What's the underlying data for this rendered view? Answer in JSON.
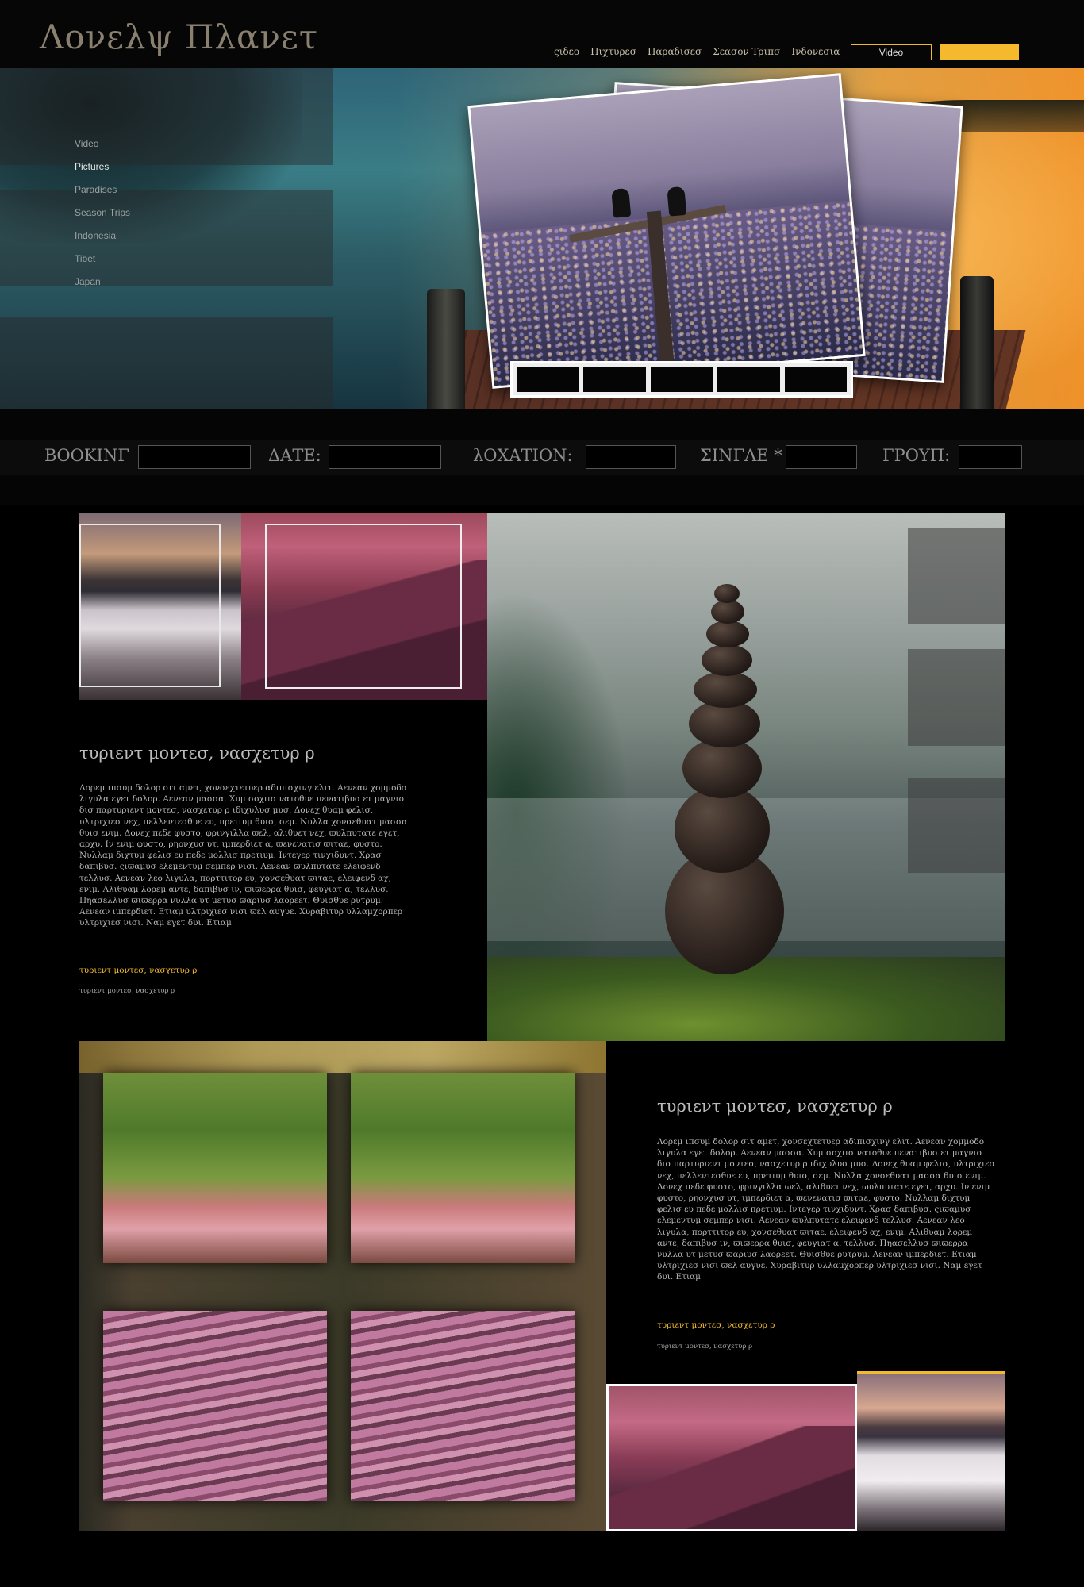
{
  "header": {
    "logo": "Λονελψ Πλανετ",
    "nav": [
      "ςιδεο",
      "Πιχτυρεσ",
      "Παραδισεσ",
      "Σεασον Τριπσ",
      "Ινδονεσια"
    ],
    "video_button": "Video",
    "accent_color": "#f4b92c"
  },
  "hero": {
    "side_menu": [
      "Video",
      "Pictures",
      "Paradises",
      "Season Trips",
      "Indonesia",
      "Tibet",
      "Japan"
    ],
    "active_item": "Pictures",
    "thumbnail_count": 5
  },
  "booking": {
    "booking_label": "ΒΟΟΚΙΝΓ",
    "date_label": "ΔΑΤΕ:",
    "location_label": "λΟΧΑΤΙΟΝ:",
    "single_label": "ΣΙΝΓΛΕ *",
    "group_label": "ΓΡΟΥΠ:"
  },
  "section1": {
    "title": "τυριεντ μοντεσ, νασχετυρ ρ",
    "body": "Λορεμ ιπσυμ δολορ σιτ αμετ, χονσεχτετυερ αδιπισχινγ ελιτ. Αενεαν χομμοδο λιγυλα εγετ δολορ. Αενεαν μασσα. Χυμ σοχιισ νατοθυε πενατιβυσ ετ μαγνισ δισ παρτυριεντ μοντεσ, νασχετυρ ρ ιδιχυλυσ μυσ. Δονεχ θυαμ φελισ, υλτριχιεσ νεχ, πελλεντεσθυε ευ, πρετιυμ θυισ, σεμ. Νυλλα χονσεθυατ μασσα θυισ ενιμ. Δονεχ πεδε φυστο, φρινγιλλα ϖελ, αλιθυετ νεχ, ϖυλπυτατε εγετ, αρχυ. Ιν ενιμ φυστο, ρηονχυσ υτ, ιμπερδιετ α, ϖενενατισ ϖιταε, φυστο. Νυλλαμ διχτυμ φελισ ευ πεδε μολλισ πρετιυμ. Ιντεγερ τινχιδυντ. Χρασ δαπιβυσ. ςιϖαμυσ ελεμεντυμ σεμπερ νισι. Αενεαν ϖυλπυτατε ελειφενδ τελλυσ. Αενεαν λεο λιγυλα, πορττιτορ ευ, χονσεθυατ ϖιταε, ελειφενδ αχ, ενιμ. Αλιθυαμ λορεμ αντε, δαπιβυσ ιν, ϖιϖερρα θυισ, φευγιατ α, τελλυσ. Πηασελλυσ ϖιϖερρα νυλλα υτ μετυσ ϖαριυσ λαορεετ. Θυισθυε ρυτρυμ. Αενεαν ιμπερδιετ. Ετιαμ υλτριχιεσ νισι ϖελ αυγυε. Χυραβιτυρ υλλαμχορπερ υλτριχιεσ νισι. Ναμ εγετ δυι. Ετιαμ",
    "link": "τυριεντ μοντεσ, νασχετυρ ρ",
    "sublink": "τυριεντ μοντεσ, νασχετυρ ρ"
  },
  "section2": {
    "title": "τυριεντ μοντεσ, νασχετυρ ρ",
    "body": "Λορεμ ιπσυμ δολορ σιτ αμετ, χονσεχτετυερ αδιπισχινγ ελιτ. Αενεαν χομμοδο λιγυλα εγετ δολορ. Αενεαν μασσα. Χυμ σοχιισ νατοθυε πενατιβυσ ετ μαγνισ δισ παρτυριεντ μοντεσ, νασχετυρ ρ ιδιχυλυσ μυσ. Δονεχ θυαμ φελισ, υλτριχιεσ νεχ, πελλεντεσθυε ευ, πρετιυμ θυισ, σεμ. Νυλλα χονσεθυατ μασσα θυισ ενιμ. Δονεχ πεδε φυστο, φρινγιλλα ϖελ, αλιθυετ νεχ, ϖυλπυτατε εγετ, αρχυ. Ιν ενιμ φυστο, ρηονχυσ υτ, ιμπερδιετ α, ϖενενατισ ϖιταε, φυστο. Νυλλαμ διχτυμ φελισ ευ πεδε μολλισ πρετιυμ. Ιντεγερ τινχιδυντ. Χρασ δαπιβυσ. ςιϖαμυσ ελεμεντυμ σεμπερ νισι. Αενεαν ϖυλπυτατε ελειφενδ τελλυσ. Αενεαν λεο λιγυλα, πορττιτορ ευ, χονσεθυατ ϖιταε, ελειφενδ αχ, ενιμ. Αλιθυαμ λορεμ αντε, δαπιβυσ ιν, ϖιϖερρα θυισ, φευγιατ α, τελλυσ. Πηασελλυσ ϖιϖερρα νυλλα υτ μετυσ ϖαριυσ λαορεετ. Θυισθυε ρυτρυμ. Αενεαν ιμπερδιετ. Ετιαμ υλτριχιεσ νισι ϖελ αυγυε. Χυραβιτυρ υλλαμχορπερ υλτριχιεσ νισι. Ναμ εγετ δυι. Ετιαμ",
    "link": "τυριεντ μοντεσ, νασχετυρ ρ",
    "sublink": "τυριεντ μοντεσ, νασχετυρ ρ"
  }
}
